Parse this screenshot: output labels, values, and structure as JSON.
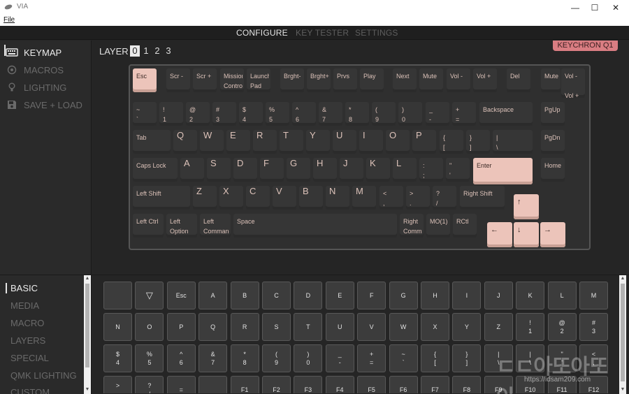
{
  "window": {
    "title": "VIA",
    "minimize": "—",
    "maximize": "☐",
    "close": "✕"
  },
  "menu": {
    "file": "File"
  },
  "top_tabs": [
    "CONFIGURE",
    "KEY TESTER",
    "SETTINGS"
  ],
  "sidebar": {
    "items": [
      {
        "label": "KEYMAP",
        "icon": "keyboard-icon",
        "active": true
      },
      {
        "label": "MACROS",
        "icon": "target-icon",
        "active": false
      },
      {
        "label": "LIGHTING",
        "icon": "lightbulb-icon",
        "active": false
      },
      {
        "label": "SAVE + LOAD",
        "icon": "floppy-disk-icon",
        "active": false
      }
    ]
  },
  "layer": {
    "label": "LAYER",
    "options": [
      "0",
      "1",
      "2",
      "3"
    ],
    "selected": "0"
  },
  "keyboard_name": "KEYCHRON Q1",
  "colors": {
    "accent_key": "#ecc4ba",
    "badge": "#d97d82",
    "key": "#363636",
    "key_text": "#dcc2b9"
  },
  "keys": [
    {
      "id": "esc",
      "label": "Esc",
      "acc": true
    },
    {
      "id": "f1",
      "label": "Scr -"
    },
    {
      "id": "f2",
      "label": "Scr +"
    },
    {
      "id": "f3",
      "label": "Mission\nControl"
    },
    {
      "id": "f4",
      "label": "Launch\nPad"
    },
    {
      "id": "f5",
      "label": "Brght-"
    },
    {
      "id": "f6",
      "label": "Brght+"
    },
    {
      "id": "f7",
      "label": "Prvs"
    },
    {
      "id": "f8",
      "label": "Play"
    },
    {
      "id": "f9",
      "label": "Next"
    },
    {
      "id": "f10",
      "label": "Mute"
    },
    {
      "id": "f11",
      "label": "Vol -"
    },
    {
      "id": "f12",
      "label": "Vol +"
    },
    {
      "id": "del",
      "label": "Del"
    },
    {
      "id": "knob",
      "label": "Mute"
    },
    {
      "id": "knobvol",
      "label": "Vol -\n\nVol +"
    },
    {
      "id": "grave",
      "label": "~\n`"
    },
    {
      "id": "n1",
      "label": "!\n1"
    },
    {
      "id": "n2",
      "label": "@\n2"
    },
    {
      "id": "n3",
      "label": "#\n3"
    },
    {
      "id": "n4",
      "label": "$\n4"
    },
    {
      "id": "n5",
      "label": "%\n5"
    },
    {
      "id": "n6",
      "label": "^\n6"
    },
    {
      "id": "n7",
      "label": "&\n7"
    },
    {
      "id": "n8",
      "label": "*\n8"
    },
    {
      "id": "n9",
      "label": "(\n9"
    },
    {
      "id": "n0",
      "label": ")\n0"
    },
    {
      "id": "minus",
      "label": "_\n-"
    },
    {
      "id": "equal",
      "label": "+\n="
    },
    {
      "id": "bksp",
      "label": "Backspace"
    },
    {
      "id": "pgup",
      "label": "PgUp"
    },
    {
      "id": "tab",
      "label": "Tab"
    },
    {
      "id": "q",
      "label": "Q",
      "big": true
    },
    {
      "id": "w",
      "label": "W",
      "big": true
    },
    {
      "id": "e",
      "label": "E",
      "big": true
    },
    {
      "id": "r",
      "label": "R",
      "big": true
    },
    {
      "id": "t",
      "label": "T",
      "big": true
    },
    {
      "id": "y",
      "label": "Y",
      "big": true
    },
    {
      "id": "u",
      "label": "U",
      "big": true
    },
    {
      "id": "i",
      "label": "I",
      "big": true
    },
    {
      "id": "o",
      "label": "O",
      "big": true
    },
    {
      "id": "p",
      "label": "P",
      "big": true
    },
    {
      "id": "lbr",
      "label": "{\n["
    },
    {
      "id": "rbr",
      "label": "}\n]"
    },
    {
      "id": "bsl",
      "label": "|\n\\"
    },
    {
      "id": "pgdn",
      "label": "PgDn"
    },
    {
      "id": "caps",
      "label": "Caps Lock"
    },
    {
      "id": "a",
      "label": "A",
      "big": true
    },
    {
      "id": "s",
      "label": "S",
      "big": true
    },
    {
      "id": "d",
      "label": "D",
      "big": true
    },
    {
      "id": "f",
      "label": "F",
      "big": true
    },
    {
      "id": "g",
      "label": "G",
      "big": true
    },
    {
      "id": "h",
      "label": "H",
      "big": true
    },
    {
      "id": "j",
      "label": "J",
      "big": true
    },
    {
      "id": "k",
      "label": "K",
      "big": true
    },
    {
      "id": "l",
      "label": "L",
      "big": true
    },
    {
      "id": "semi",
      "label": ":\n;"
    },
    {
      "id": "quote",
      "label": "\"\n'"
    },
    {
      "id": "enter",
      "label": "Enter",
      "acc": true
    },
    {
      "id": "home",
      "label": "Home"
    },
    {
      "id": "lshift",
      "label": "Left Shift"
    },
    {
      "id": "z",
      "label": "Z",
      "big": true
    },
    {
      "id": "x",
      "label": "X",
      "big": true
    },
    {
      "id": "c",
      "label": "C",
      "big": true
    },
    {
      "id": "v",
      "label": "V",
      "big": true
    },
    {
      "id": "b",
      "label": "B",
      "big": true
    },
    {
      "id": "nn",
      "label": "N",
      "big": true
    },
    {
      "id": "m",
      "label": "M",
      "big": true
    },
    {
      "id": "comma",
      "label": "<\n,"
    },
    {
      "id": "dot",
      "label": ">\n."
    },
    {
      "id": "slash",
      "label": "?\n/"
    },
    {
      "id": "rshift",
      "label": "Right Shift"
    },
    {
      "id": "up",
      "label": "↑",
      "acc": true,
      "arrow": true
    },
    {
      "id": "lctrl",
      "label": "Left Ctrl"
    },
    {
      "id": "lopt",
      "label": "Left\nOption"
    },
    {
      "id": "lcmd",
      "label": "Left\nCommand"
    },
    {
      "id": "space",
      "label": "Space"
    },
    {
      "id": "rcmd",
      "label": "Right\nCommand"
    },
    {
      "id": "mo1",
      "label": "MO(1)"
    },
    {
      "id": "rctl",
      "label": "RCtl"
    },
    {
      "id": "left",
      "label": "←",
      "acc": true,
      "arrow": true
    },
    {
      "id": "down",
      "label": "↓",
      "acc": true,
      "arrow": true
    },
    {
      "id": "right",
      "label": "→",
      "acc": true,
      "arrow": true
    }
  ],
  "bottom_menu": [
    {
      "label": "BASIC",
      "active": true
    },
    {
      "label": "MEDIA"
    },
    {
      "label": "MACRO"
    },
    {
      "label": "LAYERS"
    },
    {
      "label": "SPECIAL"
    },
    {
      "label": "QMK LIGHTING"
    },
    {
      "label": "CUSTOM"
    }
  ],
  "keycode_grid": [
    "",
    "▽",
    "Esc",
    "A",
    "B",
    "C",
    "D",
    "E",
    "F",
    "G",
    "H",
    "I",
    "J",
    "K",
    "L",
    "M",
    "N",
    "O",
    "P",
    "Q",
    "R",
    "S",
    "T",
    "U",
    "V",
    "W",
    "X",
    "Y",
    "Z",
    "!\n1",
    "@\n2",
    "#\n3",
    "$\n4",
    "%\n5",
    "^\n6",
    "&\n7",
    "*\n8",
    "(\n9",
    ")\n0",
    "_\n-",
    "+\n=",
    "~\n`",
    "{\n[",
    "}\n]",
    "|\n\\",
    "|\n\\",
    "\"\n'",
    "<\n,",
    ">\n.",
    "?\n/",
    "=",
    "",
    "F1",
    "F2",
    "F3",
    "F4",
    "F5",
    "F6",
    "F7",
    "F8",
    "F9",
    "F10",
    "F11",
    "F12"
  ],
  "watermark": {
    "title": "ㄷㄷ아또아또아",
    "url": "https://idsam209.com"
  }
}
